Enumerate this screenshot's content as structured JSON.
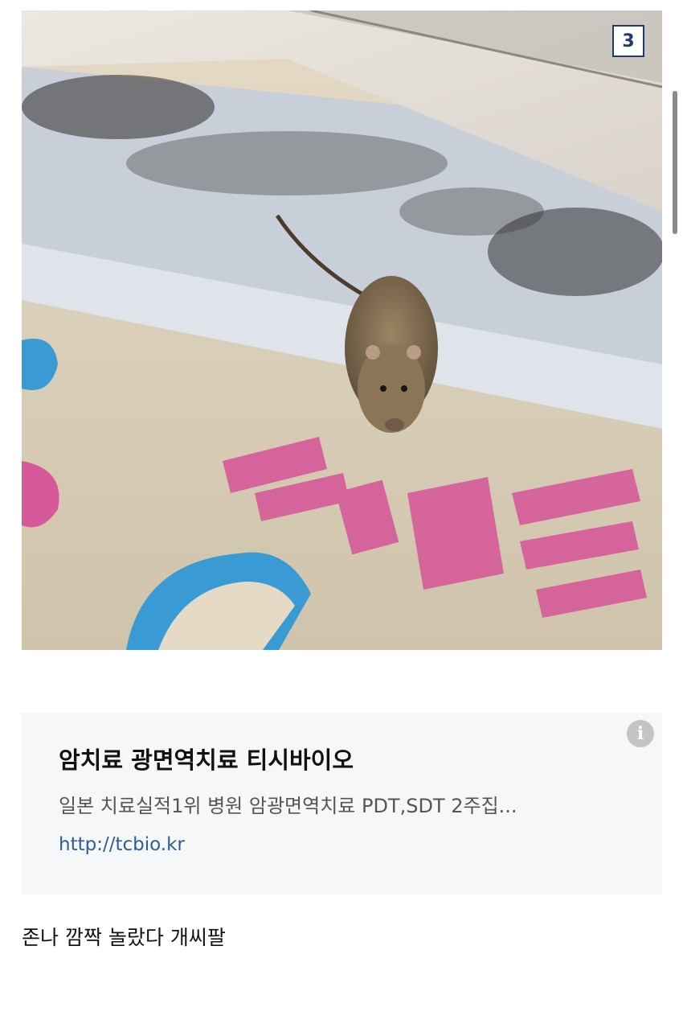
{
  "photo": {
    "page_number": "3"
  },
  "ad": {
    "info_icon": "info-icon",
    "title": "암치료 광면역치료 티시바이오",
    "description": "일본 치료실적1위 병원 암광면역치료 PDT,SDT 2주집...",
    "url": "http://tcbio.kr"
  },
  "caption": "존나 깜짝 놀랐다 개씨팔",
  "colors": {
    "badge_border": "#1f3a6b",
    "link": "#2f5d9a",
    "ad_background": "#f6f7f8"
  }
}
